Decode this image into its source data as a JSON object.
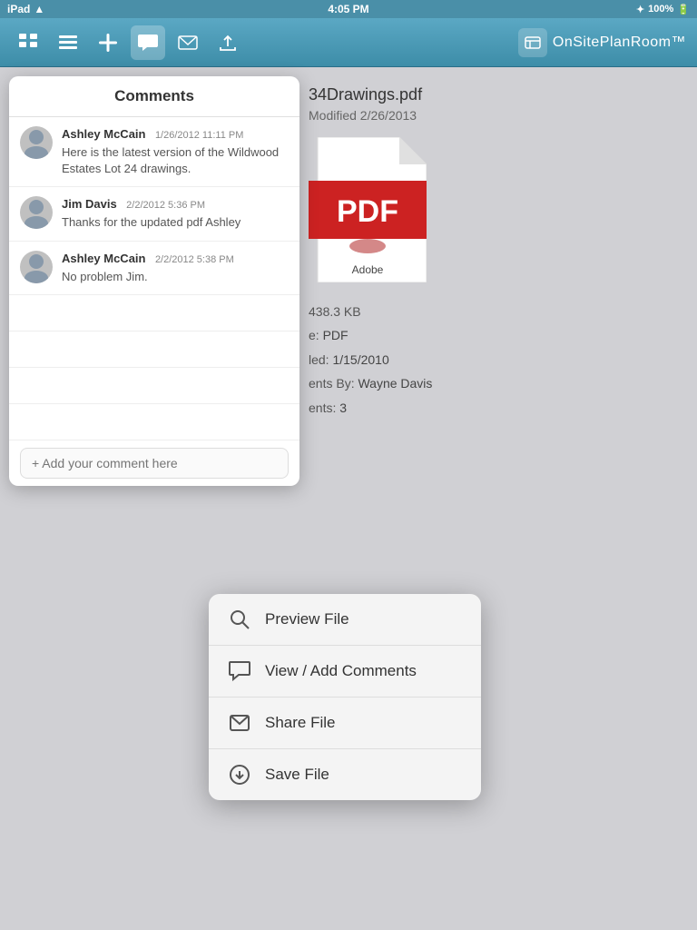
{
  "statusBar": {
    "carrier": "iPad",
    "wifi": "WiFi",
    "time": "4:05 PM",
    "bluetooth": "BT",
    "battery": "100%"
  },
  "toolbar": {
    "icons": [
      {
        "name": "grid-view-icon",
        "symbol": "▦"
      },
      {
        "name": "list-view-icon",
        "symbol": "≡"
      },
      {
        "name": "add-icon",
        "symbol": "+"
      },
      {
        "name": "comment-icon",
        "symbol": "💬"
      },
      {
        "name": "mail-icon",
        "symbol": "✉"
      },
      {
        "name": "export-icon",
        "symbol": "⤴"
      }
    ],
    "logo": "OnSitePlanRoom™"
  },
  "fileDetail": {
    "title": "34Drawings.pdf",
    "modified": "Modified 2/26/2013",
    "size": "438.3 KB",
    "type": "PDF",
    "uploaded": "1/15/2010",
    "uploadedBy": "Wayne Davis",
    "comments": "3"
  },
  "commentsPanel": {
    "title": "Comments",
    "comments": [
      {
        "author": "Ashley McCain",
        "date": "1/26/2012 11:11 PM",
        "text": "Here is the latest version of the Wildwood Estates Lot 24 drawings."
      },
      {
        "author": "Jim Davis",
        "date": "2/2/2012 5:36 PM",
        "text": "Thanks for the updated pdf Ashley"
      },
      {
        "author": "Ashley McCain",
        "date": "2/2/2012 5:38 PM",
        "text": "No problem Jim."
      }
    ],
    "inputPlaceholder": "+ Add your comment here"
  },
  "contextMenu": {
    "items": [
      {
        "label": "Preview File",
        "icon": "search-icon"
      },
      {
        "label": "View / Add Comments",
        "icon": "comment-menu-icon"
      },
      {
        "label": "Share File",
        "icon": "share-file-icon"
      },
      {
        "label": "Save File",
        "icon": "save-file-icon"
      }
    ]
  }
}
